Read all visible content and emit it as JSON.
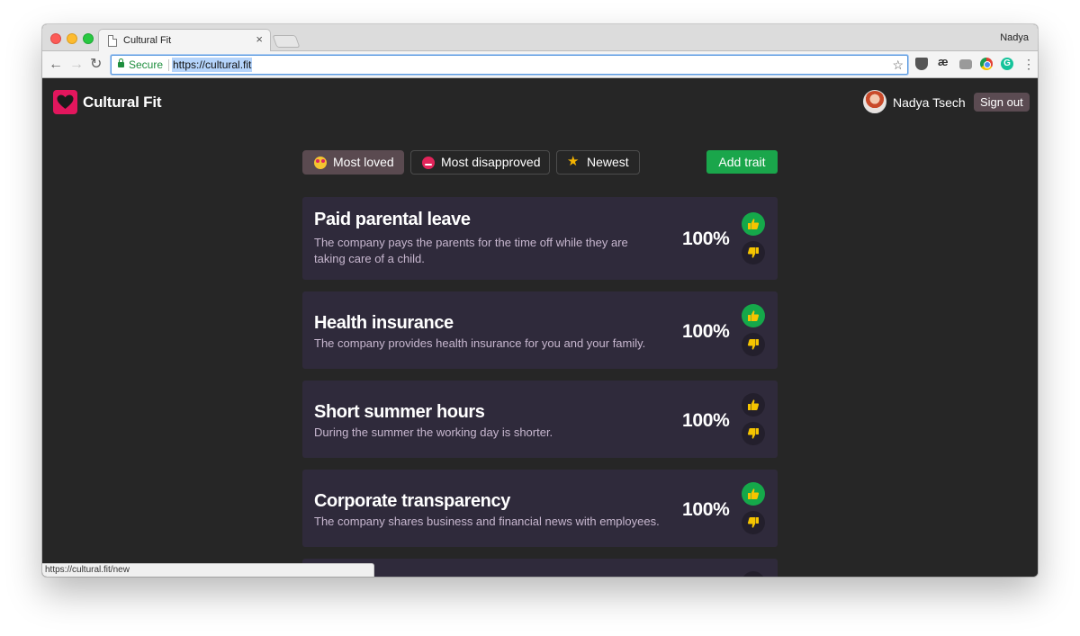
{
  "browser": {
    "tab_title": "Cultural Fit",
    "tab_close": "×",
    "profile_name": "Nadya",
    "secure_label": "Secure",
    "url": "https://cultural.fit",
    "status_url": "https://cultural.fit/new",
    "icons": {
      "back": "arrow-left",
      "forward": "arrow-right",
      "reload": "reload",
      "star": "star",
      "menu": "kebab"
    }
  },
  "app": {
    "brand": "Cultural Fit",
    "brand_color": "#e2165d",
    "user_name": "Nadya Tsech",
    "sign_out_label": "Sign out"
  },
  "filters": {
    "most_loved": "Most loved",
    "most_disapproved": "Most disapproved",
    "newest": "Newest",
    "active": "most_loved"
  },
  "add_trait_label": "Add trait",
  "accent_color": "#1aa64b",
  "traits": [
    {
      "title": "Paid parental leave",
      "description": "The company pays the parents for the time off while they are taking care of a child.",
      "percent": "100%",
      "upvoted": true
    },
    {
      "title": "Health insurance",
      "description": "The company provides health insurance for you and your family.",
      "percent": "100%",
      "upvoted": true
    },
    {
      "title": "Short summer hours",
      "description": "During the summer the working day is shorter.",
      "percent": "100%",
      "upvoted": false
    },
    {
      "title": "Corporate transparency",
      "description": "The company shares business and financial news with employees.",
      "percent": "100%",
      "upvoted": true
    }
  ]
}
